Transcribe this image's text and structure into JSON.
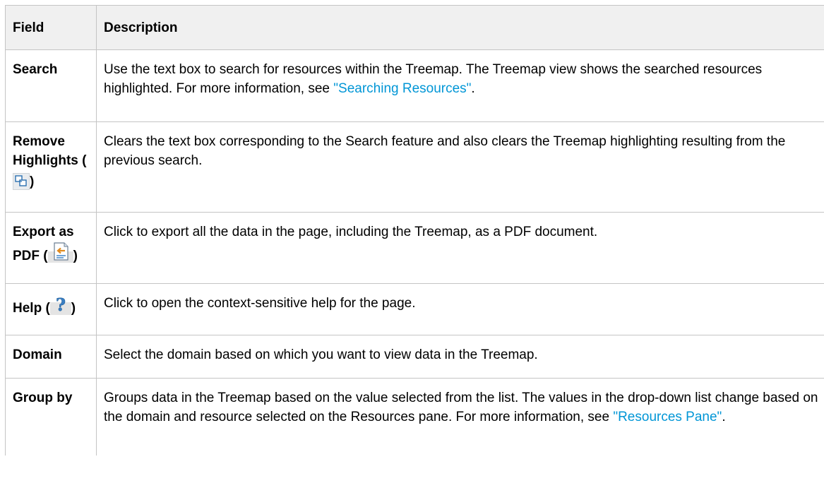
{
  "table": {
    "headers": {
      "field": "Field",
      "description": "Description"
    },
    "rows": [
      {
        "field": "Search",
        "description_text": "Use the text box to search for resources within the Treemap. The Treemap view shows the searched resources highlighted. For more information, see ",
        "description_link": "\"Searching Resources\"",
        "description_after": "."
      },
      {
        "field_line1": "Remove",
        "field_line2": "Highlights (",
        "field_close": ")",
        "field_icon": "remove-highlights-icon",
        "description_text": "Clears the text box corresponding to the Search feature and also clears the Treemap highlighting resulting from the previous search."
      },
      {
        "field_line1": "Export as",
        "field_line2": "PDF (",
        "field_close": ")",
        "field_icon": "export-pdf-icon",
        "description_text": "Click to export all the data in the page, including the Treemap, as a PDF document."
      },
      {
        "field_line1": "Help (",
        "field_close": ")",
        "field_icon": "help-icon",
        "description_text": "Click to open the context-sensitive help for the page."
      },
      {
        "field": "Domain",
        "description_text": "Select the domain based on which you want to view data in the Treemap."
      },
      {
        "field": "Group by",
        "description_text": "Groups data in the Treemap based on the value selected from the list. The values in the drop-down list change based on the domain and resource selected on the Resources pane. For more information, see ",
        "description_link": "\"Resources Pane\"",
        "description_after": "."
      }
    ]
  },
  "colors": {
    "link": "#0096d6",
    "header_bg": "#f0f0f0",
    "border": "#c4c4c4"
  }
}
